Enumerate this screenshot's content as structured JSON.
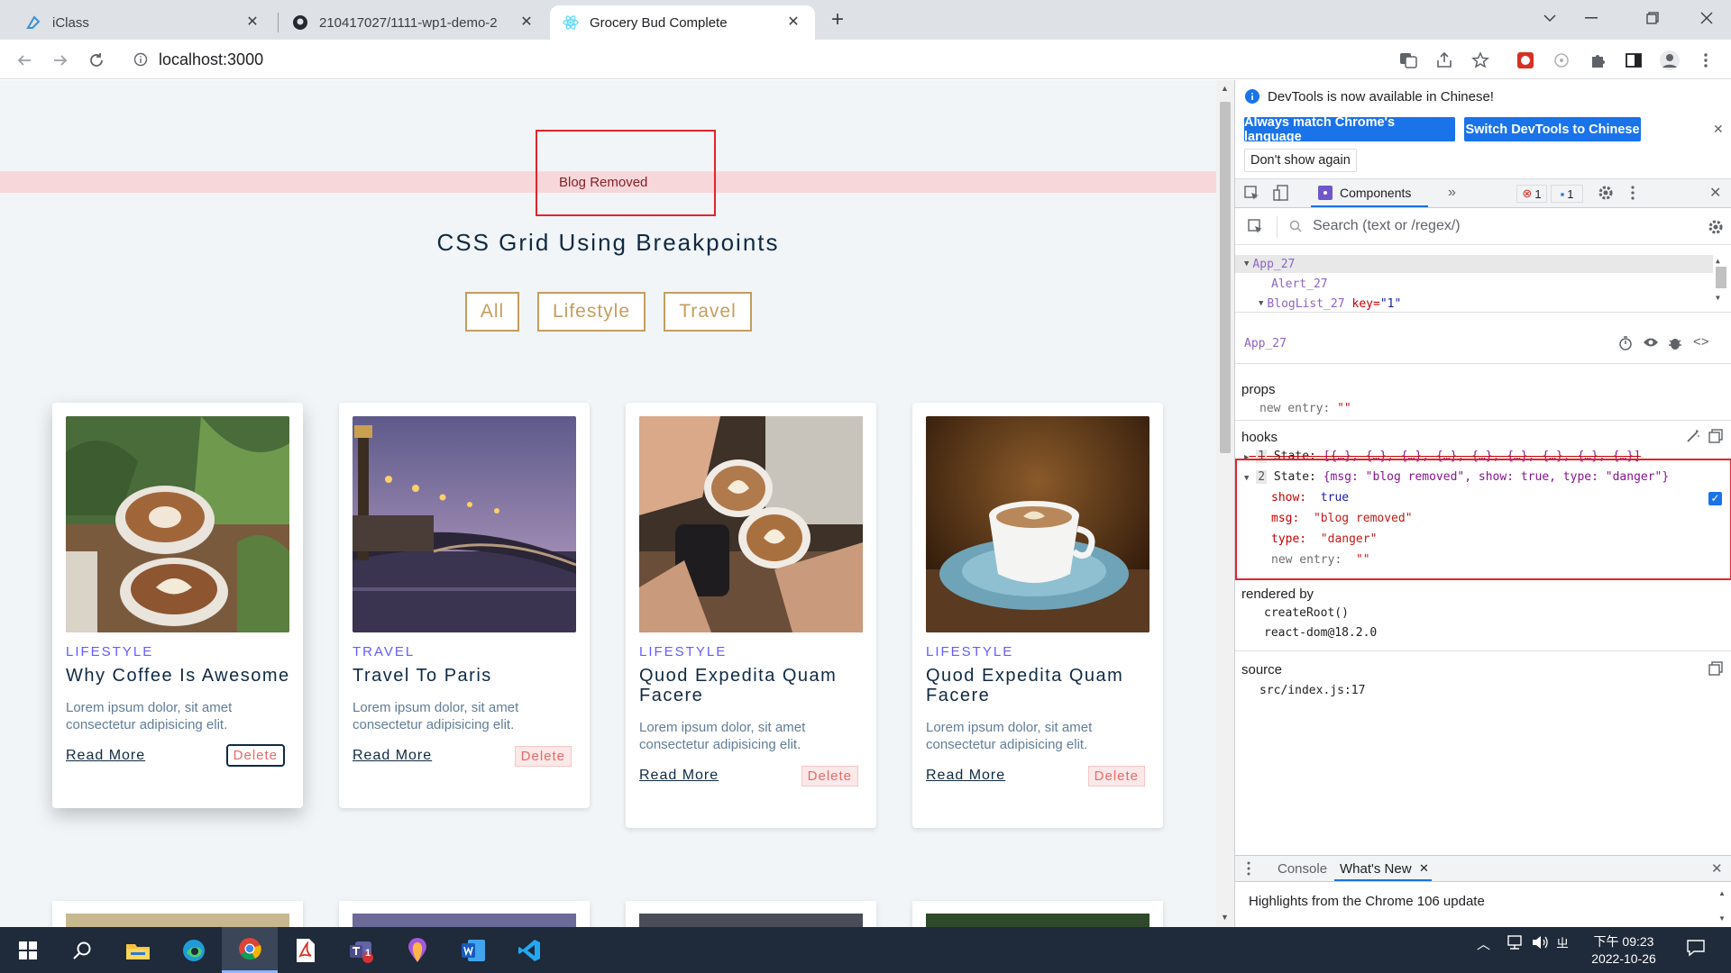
{
  "browser": {
    "tabs": [
      {
        "title": "iClass",
        "icon": "iclass-icon"
      },
      {
        "title": "210417027/1111-wp1-demo-2",
        "icon": "github-icon"
      },
      {
        "title": "Grocery Bud Complete",
        "icon": "react-icon"
      }
    ],
    "new_tab_symbol": "+",
    "url": "localhost:3000"
  },
  "page": {
    "alert": "Blog Removed",
    "title": "CSS Grid Using Breakpoints",
    "filters": [
      "All",
      "Lifestyle",
      "Travel"
    ],
    "cards": [
      {
        "category": "LIFESTYLE",
        "title": "Why Coffee Is Awesome",
        "desc": "Lorem ipsum dolor, sit amet consectetur adipisicing elit.",
        "read_more": "Read More",
        "delete": "Delete"
      },
      {
        "category": "TRAVEL",
        "title": "Travel To Paris",
        "desc": "Lorem ipsum dolor, sit amet consectetur adipisicing elit.",
        "read_more": "Read More",
        "delete": "Delete"
      },
      {
        "category": "LIFESTYLE",
        "title": "Quod Expedita Quam Facere",
        "desc": "Lorem ipsum dolor, sit amet consectetur adipisicing elit.",
        "read_more": "Read More",
        "delete": "Delete"
      },
      {
        "category": "LIFESTYLE",
        "title": "Quod Expedita Quam Facere",
        "desc": "Lorem ipsum dolor, sit amet consectetur adipisicing elit.",
        "read_more": "Read More",
        "delete": "Delete"
      }
    ]
  },
  "devtools": {
    "info": "DevTools is now available in Chinese!",
    "btn_match": "Always match Chrome's language",
    "btn_switch": "Switch DevTools to Chinese",
    "btn_dont_show": "Don't show again",
    "panel_tab": "Components",
    "error_count": "1",
    "message_count": "1",
    "search_placeholder": "Search (text or /regex/)",
    "tree": [
      {
        "name": "App_27"
      },
      {
        "name": "Alert_27"
      },
      {
        "name": "BlogList_27",
        "key_label": "key=",
        "key_value": "\"1\""
      }
    ],
    "selected": "App_27",
    "props_header": "props",
    "props_new_entry_key": "new entry:",
    "props_new_entry_val": "\"\"",
    "hooks_header": "hooks",
    "hook1": {
      "index": "1",
      "label": "State:",
      "value": "[{…}, {…}, {…}, {…}, {…}, {…}, {…}, {…}, {…}]"
    },
    "hook2": {
      "index": "2",
      "label": "State:",
      "value": "{msg: \"blog removed\", show: true, type: \"danger\"}"
    },
    "hook2_fields": [
      {
        "key": "show:",
        "value": "true"
      },
      {
        "key": "msg:",
        "value": "\"blog removed\""
      },
      {
        "key": "type:",
        "value": "\"danger\""
      },
      {
        "key": "new entry:",
        "value": "\"\""
      }
    ],
    "rendered_by_header": "rendered by",
    "rendered_by": [
      "createRoot()",
      "react-dom@18.2.0"
    ],
    "source_header": "source",
    "source": "src/index.js:17",
    "drawer_tabs": [
      "Console",
      "What's New"
    ],
    "whats_new": "Highlights from the Chrome 106 update"
  },
  "taskbar": {
    "time": "下午 09:23",
    "date": "2022-10-26",
    "teams_badge": "1"
  },
  "colors": {
    "accent": "#c59d5f",
    "alert_bg": "#f8d7da",
    "highlight_box": "#e3242b",
    "devtools_blue": "#1a73e8"
  }
}
